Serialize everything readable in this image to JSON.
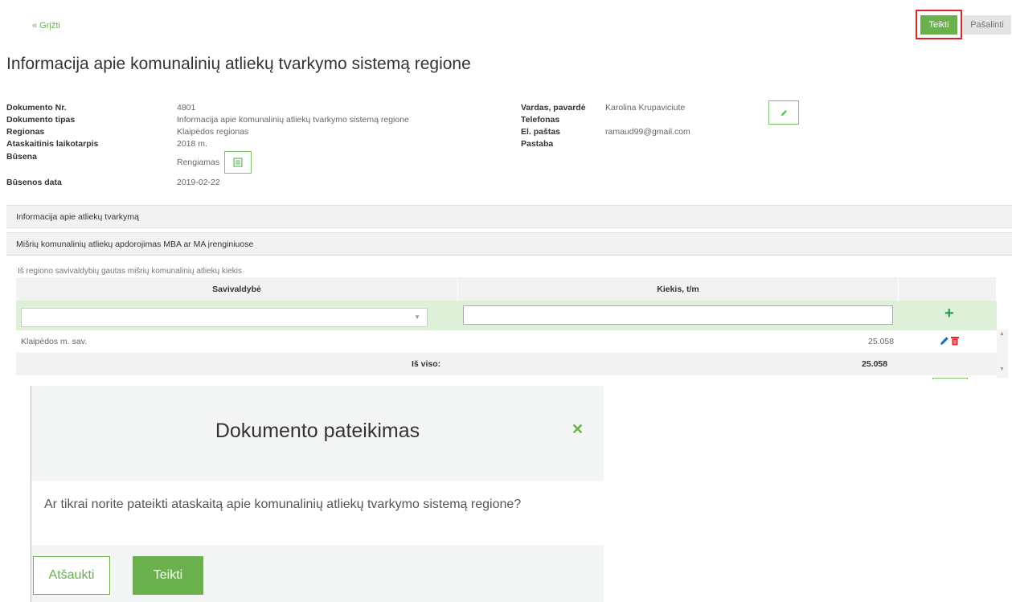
{
  "header": {
    "back_link": "« Grįžti",
    "submit_button": "Teikti",
    "remove_button": "Pašalinti"
  },
  "page_title": "Informacija apie komunalinių atliekų tvarkymo sistemą regione",
  "document_info": {
    "doc_nr_label": "Dokumento Nr.",
    "doc_nr_value": "4801",
    "doc_type_label": "Dokumento tipas",
    "doc_type_value": "Informacija apie komunalinių atliekų tvarkymo sistemą regione",
    "region_label": "Regionas",
    "region_value": "Klaipėdos regionas",
    "period_label": "Ataskaitinis laikotarpis",
    "period_value": "2018 m.",
    "status_label": "Būsena",
    "status_value": "Rengiamas",
    "status_date_label": "Būsenos data",
    "status_date_value": "2019-02-22"
  },
  "contact_info": {
    "name_label": "Vardas, pavardė",
    "name_value": "Karolina Krupaviciute",
    "phone_label": "Telefonas",
    "email_label": "El. paštas",
    "email_value": "ramaud99@gmail.com",
    "note_label": "Pastaba"
  },
  "sections": {
    "waste_info": "Informacija apie atliekų tvarkymą",
    "mba_section": "Mišrių komunalinių atliekų apdorojimas MBA ar MA įrenginiuose"
  },
  "table": {
    "caption": "Iš regiono savivaldybių gautas mišrių komunalinių atliekų kiekis",
    "columns": [
      "Savivaldybė",
      "Kiekis, t/m"
    ],
    "rows": [
      {
        "municipality": "Klaipėdos m. sav.",
        "quantity": "25.058"
      }
    ],
    "total_label": "Iš viso:",
    "total_value": "25.058"
  },
  "modal": {
    "title": "Dokumento pateikimas",
    "message": "Ar tikrai norite pateikti ataskaitą apie komunalinių atliekų tvarkymo sistemą regione?",
    "cancel_button": "Atšaukti",
    "confirm_button": "Teikti"
  },
  "colors": {
    "accent_green": "#6ab04c",
    "danger_red": "#e0202a",
    "input_row_green": "#dff0d8"
  },
  "icons": [
    "list-icon",
    "pencil-icon",
    "plus-icon",
    "trash-icon",
    "close-icon"
  ]
}
